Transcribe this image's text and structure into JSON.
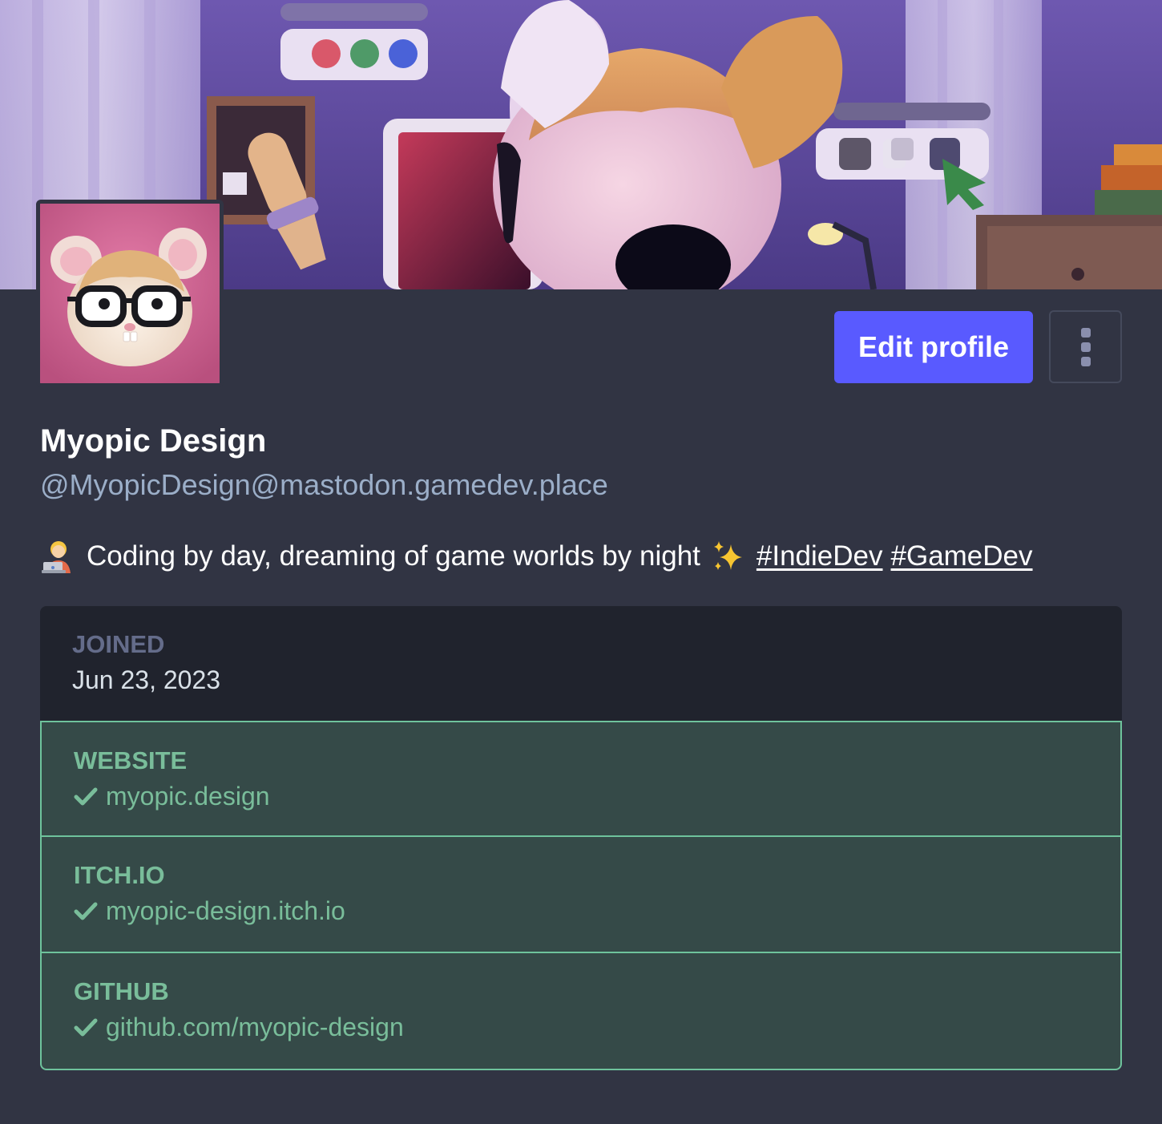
{
  "profile": {
    "display_name": "Myopic Design",
    "handle": "@MyopicDesign@mastodon.gamedev.place",
    "bio_text": "Coding by day, dreaming of game worlds by night",
    "bio_emoji_start": "technologist-emoji",
    "bio_emoji_end": "sparkles-emoji",
    "hashtags": [
      "#IndieDev",
      "#GameDev"
    ]
  },
  "actions": {
    "edit_profile_label": "Edit profile",
    "menu_icon": "vertical-ellipsis-icon"
  },
  "fields": {
    "joined": {
      "label": "JOINED",
      "value": "Jun 23, 2023"
    },
    "verified": [
      {
        "label": "WEBSITE",
        "value": "myopic.design"
      },
      {
        "label": "ITCH.IO",
        "value": "myopic-design.itch.io"
      },
      {
        "label": "GITHUB",
        "value": "github.com/myopic-design"
      }
    ]
  },
  "colors": {
    "background": "#313443",
    "accent": "#595aff",
    "handle": "#9baec8",
    "verified_green": "#79bd9a",
    "verified_bg": "#354a48",
    "joined_bg": "#20232d"
  }
}
